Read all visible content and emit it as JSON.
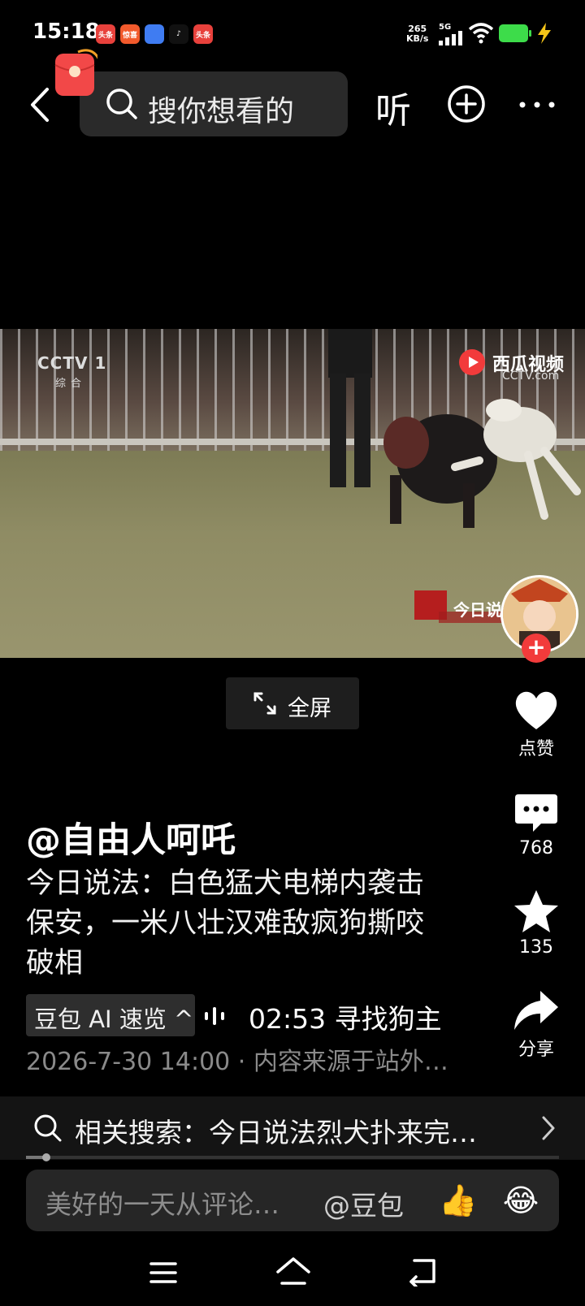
{
  "status_bar": {
    "time": "15:18",
    "app_icons": [
      {
        "name": "toutiao-icon",
        "text": "头条",
        "color": "#e8413c"
      },
      {
        "name": "gift-app-icon",
        "text": "惊喜",
        "color": "#f25a2c"
      },
      {
        "name": "blue-app-icon",
        "text": "",
        "color": "#3f7cf2"
      },
      {
        "name": "tiktok-icon",
        "text": "♪",
        "color": "#111111"
      },
      {
        "name": "toutiao-icon-2",
        "text": "头条",
        "color": "#e8413c"
      }
    ],
    "net_speed_value": "265",
    "net_speed_unit": "KB/s",
    "network": "5G",
    "battery_color": "#3ddc4a"
  },
  "top_bar": {
    "search_placeholder": "搜你想看的",
    "listen_label": "听"
  },
  "video": {
    "channel_logo": "CCTV 1",
    "channel_sub": "综合",
    "watermark": "西瓜视频",
    "watermark_sub": "CCTV.com",
    "program_text": "今日说",
    "follow_label": "+"
  },
  "fullscreen_label": "全屏",
  "actions": {
    "like_label": "点赞",
    "comment_count": "768",
    "favorite_count": "135",
    "share_label": "分享"
  },
  "post": {
    "author": "@自由人呵吒",
    "title": "今日说法：白色猛犬电梯内袭击保安，一米八壮汉难敌疯狗撕咬破相",
    "ai_summary_label": "豆包 AI 速览 ^",
    "chapter": "02:53 寻找狗主",
    "meta": "2026-7-30 14:00 · 内容来源于站外…"
  },
  "related_search": {
    "text": "相关搜索：今日说法烈犬扑来完…"
  },
  "comment_bar": {
    "placeholder": "美好的一天从评论…",
    "mention": "@豆包",
    "thumbs_emoji": "👍",
    "laugh_emoji": "😂"
  }
}
